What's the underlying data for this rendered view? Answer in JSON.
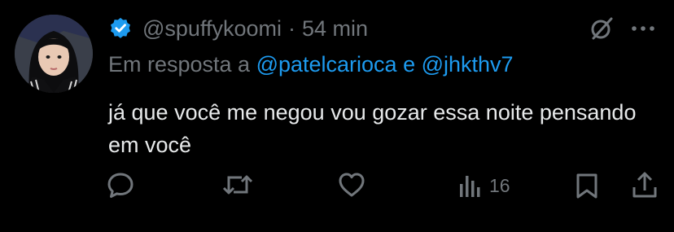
{
  "tweet": {
    "handle": "@spuffykoomi",
    "separator": "·",
    "time": "54 min",
    "reply_prefix": "Em resposta a ",
    "reply_mention_1": "@patelcarioca",
    "reply_and": " e ",
    "reply_mention_2": "@jhkthv7",
    "text": "já que você me negou vou gozar essa noite pensando em você",
    "views_count": "16"
  },
  "icons": {
    "avatar": "profile-photo",
    "verified": "verified-badge-icon",
    "grok": "grok-icon",
    "more": "more-icon",
    "reply": "reply-icon",
    "retweet": "retweet-icon",
    "like": "heart-icon",
    "views": "views-icon",
    "bookmark": "bookmark-icon",
    "share": "share-icon"
  },
  "colors": {
    "background": "#000000",
    "text": "#e7e9ea",
    "muted": "#71767b",
    "accent": "#1d9bf0"
  }
}
